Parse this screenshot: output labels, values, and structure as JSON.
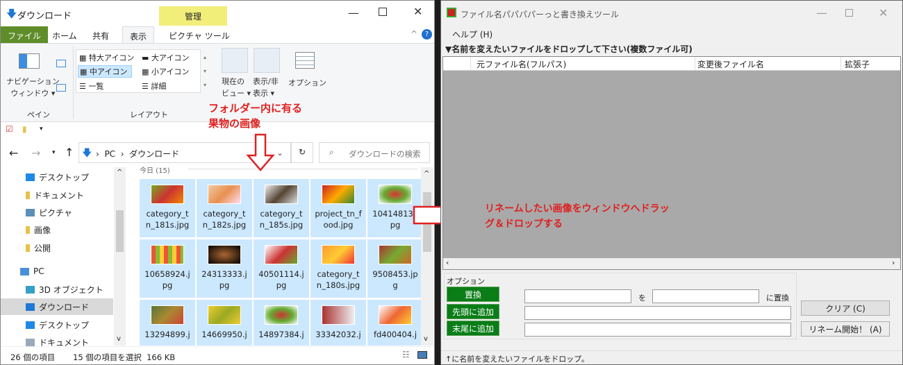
{
  "explorer": {
    "title": "ダウンロード",
    "manage_tab": "管理",
    "tabs": [
      "ファイル",
      "ホーム",
      "共有",
      "表示",
      "ピクチャ ツール"
    ],
    "ribbon": {
      "nav_pane": "ナビゲーション\nウィンドウ ▾",
      "pane_group": "ペイン",
      "layout_items": [
        "特大アイコン",
        "大アイコン",
        "中アイコン",
        "小アイコン",
        "一覧",
        "詳細"
      ],
      "layout_group": "レイアウト",
      "current_view": "現在の\nビュー ▾",
      "show_hide": "表示/非\n表示 ▾",
      "options": "オプション"
    },
    "address": {
      "parts": [
        "PC",
        "ダウンロード"
      ],
      "search_placeholder": "ダウンロードの検索"
    },
    "group_header": "今日 (15)",
    "nav": [
      {
        "label": "デスクトップ",
        "icon": "desktop-icon"
      },
      {
        "label": "ドキュメント",
        "icon": "folder-icon"
      },
      {
        "label": "ピクチャ",
        "icon": "pictures-icon"
      },
      {
        "label": "画像",
        "icon": "folder-icon"
      },
      {
        "label": "公開",
        "icon": "folder-icon"
      },
      {
        "label": "PC",
        "icon": "pc-icon"
      },
      {
        "label": "3D オブジェクト",
        "icon": "3d-objects-icon"
      },
      {
        "label": "ダウンロード",
        "icon": "download-icon"
      },
      {
        "label": "デスクトップ",
        "icon": "desktop-icon"
      },
      {
        "label": "ドキュメント",
        "icon": "document-icon"
      }
    ],
    "files": [
      "category_t\nn_181s.jpg",
      "category_t\nn_182s.jpg",
      "category_t\nn_185s.jpg",
      "project_tn_f\nood.jpg",
      "10414813.j\npg",
      "10658924.j\npg",
      "24313333.j\npg",
      "40501114.j\npg",
      "category_t\nn_180s.jpg",
      "9508453.jp\ng",
      "13294899.j",
      "14669950.j",
      "14897384.j",
      "33342032.j",
      "fd400404.j"
    ],
    "status": {
      "count": "26 個の項目",
      "selected": "15 個の項目を選択  166 KB"
    }
  },
  "annotations": {
    "folder": "フォルダー内に有る\n果物の画像",
    "drag": "リネームしたい画像をウィンドウへドラッ\nグ＆ドロップする"
  },
  "tool": {
    "title": "ファイル名パパパパーっと書き換えツール",
    "menu": "ヘルプ (H)",
    "drop_label": "▼名前を変えたいファイルをドロップして下さい(複数ファイル可)",
    "columns": [
      "元ファイル名(フルパス)",
      "変更後ファイル名",
      "拡張子"
    ],
    "options_label": "オプション",
    "replace": "置換",
    "wo": "を",
    "ni_replace": "に置換",
    "prefix": "先頭に追加",
    "suffix": "末尾に追加",
    "clear": "クリア (C)",
    "rename": "リネーム開始！ (A)",
    "status": "↑に名前を変えたいファイルをドロップ。"
  },
  "colors": {
    "accent": "#0a7d17",
    "selection": "#cce8ff",
    "annotation": "#e02020"
  }
}
